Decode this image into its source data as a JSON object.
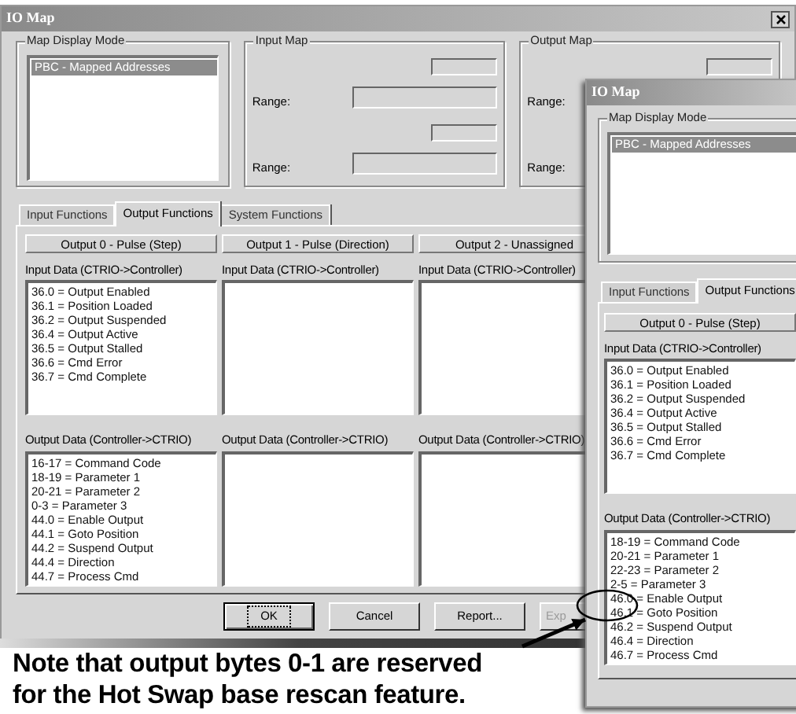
{
  "main_window": {
    "title": "IO Map",
    "map_display_mode": {
      "label": "Map Display Mode",
      "items": [
        {
          "text": "PBC - Mapped Addresses",
          "selected": true
        }
      ]
    },
    "input_map": {
      "label": "Input Map",
      "range_labels": [
        "Range:",
        "Range:"
      ]
    },
    "output_map": {
      "label": "Output Map",
      "range_labels": [
        "Range:",
        "Range:"
      ]
    },
    "tabs": [
      {
        "label": "Input Functions",
        "selected": false
      },
      {
        "label": "Output Functions",
        "selected": true
      },
      {
        "label": "System Functions",
        "selected": false
      }
    ],
    "outputs": [
      {
        "header": "Output 0 - Pulse (Step)",
        "input_label": "Input Data (CTRIO->Controller)",
        "input_items": [
          "36.0 = Output Enabled",
          "36.1 = Position Loaded",
          "36.2 = Output Suspended",
          "36.4 = Output Active",
          "36.5 = Output Stalled",
          "36.6 = Cmd Error",
          "36.7 = Cmd Complete"
        ],
        "output_label": "Output Data (Controller->CTRIO)",
        "output_items": [
          "16-17 = Command Code",
          "18-19 = Parameter 1",
          "20-21 = Parameter 2",
          "0-3 = Parameter 3",
          "44.0 = Enable Output",
          "44.1 = Goto Position",
          "44.2 = Suspend Output",
          "44.4 = Direction",
          "44.7 = Process Cmd"
        ]
      },
      {
        "header": "Output 1 - Pulse (Direction)",
        "input_label": "Input Data (CTRIO->Controller)",
        "output_label": "Output Data (Controller->CTRIO)"
      },
      {
        "header": "Output 2 - Unassigned",
        "input_label": "Input Data (CTRIO->Controller)",
        "output_label": "Output Data (Controller->CTRIO)"
      }
    ],
    "buttons": [
      {
        "label": "OK",
        "focused": true,
        "disabled": false
      },
      {
        "label": "Cancel",
        "focused": false,
        "disabled": false
      },
      {
        "label": "Report...",
        "focused": false,
        "disabled": false
      },
      {
        "label": "Exp",
        "focused": false,
        "disabled": true
      }
    ]
  },
  "second_window": {
    "title": "IO Map",
    "map_display_mode": {
      "label": "Map Display Mode",
      "items": [
        {
          "text": "PBC - Mapped Addresses",
          "selected": true
        }
      ]
    },
    "tabs": [
      {
        "label": "Input Functions",
        "selected": false
      },
      {
        "label": "Output Functions",
        "selected": true
      }
    ],
    "outputs": [
      {
        "header": "Output 0 - Pulse (Step)",
        "input_label": "Input Data (CTRIO->Controller)",
        "input_items": [
          "36.0 = Output Enabled",
          "36.1 = Position Loaded",
          "36.2 = Output Suspended",
          "36.4 = Output Active",
          "36.5 = Output Stalled",
          "36.6 = Cmd Error",
          "36.7 = Cmd Complete"
        ],
        "output_label": "Output Data (Controller->CTRIO)",
        "output_items": [
          "18-19 = Command Code",
          "20-21 = Parameter 1",
          "22-23 = Parameter 2",
          "2-5 = Parameter 3",
          "46.0 = Enable Output",
          "46.1 = Goto Position",
          "46.2 = Suspend Output",
          "46.4 = Direction",
          "46.7 = Process Cmd"
        ]
      }
    ]
  },
  "annotation": {
    "text": "Note that output bytes 0-1 are reserved for the Hot Swap base rescan feature."
  }
}
